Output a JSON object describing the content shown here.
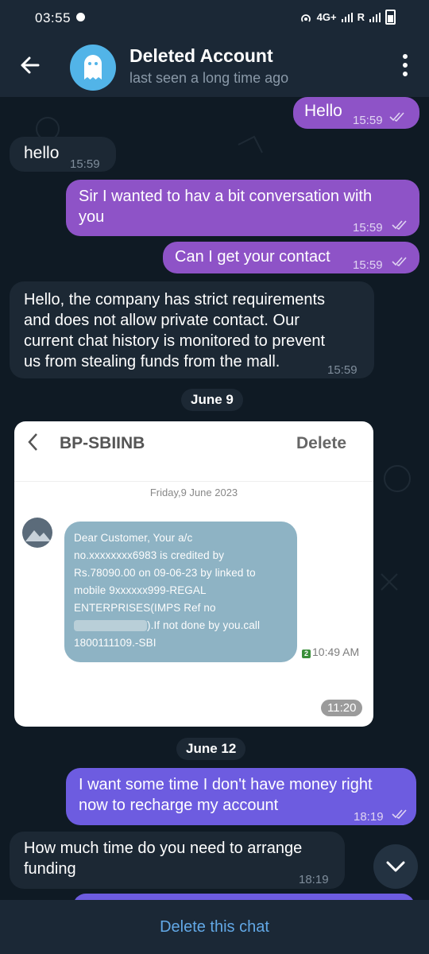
{
  "status": {
    "time": "03:55",
    "network_1": "4G+",
    "network_2": "R"
  },
  "header": {
    "title": "Deleted Account",
    "subtitle": "last seen a long time ago"
  },
  "messages": [
    {
      "dir": "out",
      "text": "Hello",
      "time": "15:59"
    },
    {
      "dir": "in",
      "text": "hello",
      "time": "15:59"
    },
    {
      "dir": "out",
      "text_line1": "Sir I wanted to hav a bit conversation with",
      "text_line2": "you",
      "time": "15:59"
    },
    {
      "dir": "out",
      "text": "Can I get your contact",
      "time": "15:59"
    },
    {
      "dir": "in",
      "lines": [
        "Hello, the company has strict requirements",
        "and does not allow private contact. Our",
        "current chat history is monitored to prevent",
        "us from stealing funds from the mall."
      ],
      "time": "15:59"
    }
  ],
  "date_1": "June 9",
  "photo": {
    "app_title": "BP-SBIINB",
    "delete_label": "Delete",
    "date": "Friday,9 June 2023",
    "sms_lines": [
      "Dear Customer, Your a/c",
      "no.xxxxxxxx6983 is credited by",
      "Rs.78090.00 on 09-06-23 by linked to",
      "mobile 9xxxxxx999-REGAL",
      "ENTERPRISES(IMPS Ref no",
      ").If not done by you.call",
      "1800111109.-SBI"
    ],
    "sms_time": "10:49 AM",
    "sim_badge": "2",
    "stamp": "11:20"
  },
  "date_2": "June 12",
  "messages_2": [
    {
      "dir": "out",
      "lines": [
        "I want some time I don't have money right",
        "now to recharge my account"
      ],
      "time": "18:19"
    },
    {
      "dir": "in",
      "lines": [
        "How much time do you need to arrange",
        "funding"
      ],
      "time": "18:19"
    }
  ],
  "bottom": {
    "action": "Delete this chat"
  },
  "colors": {
    "outgoing_bubble": "#8e53c7",
    "outgoing_bubble_recent": "#6d5ce0",
    "incoming_bubble": "#1c2834",
    "accent_link": "#62a8e6"
  }
}
